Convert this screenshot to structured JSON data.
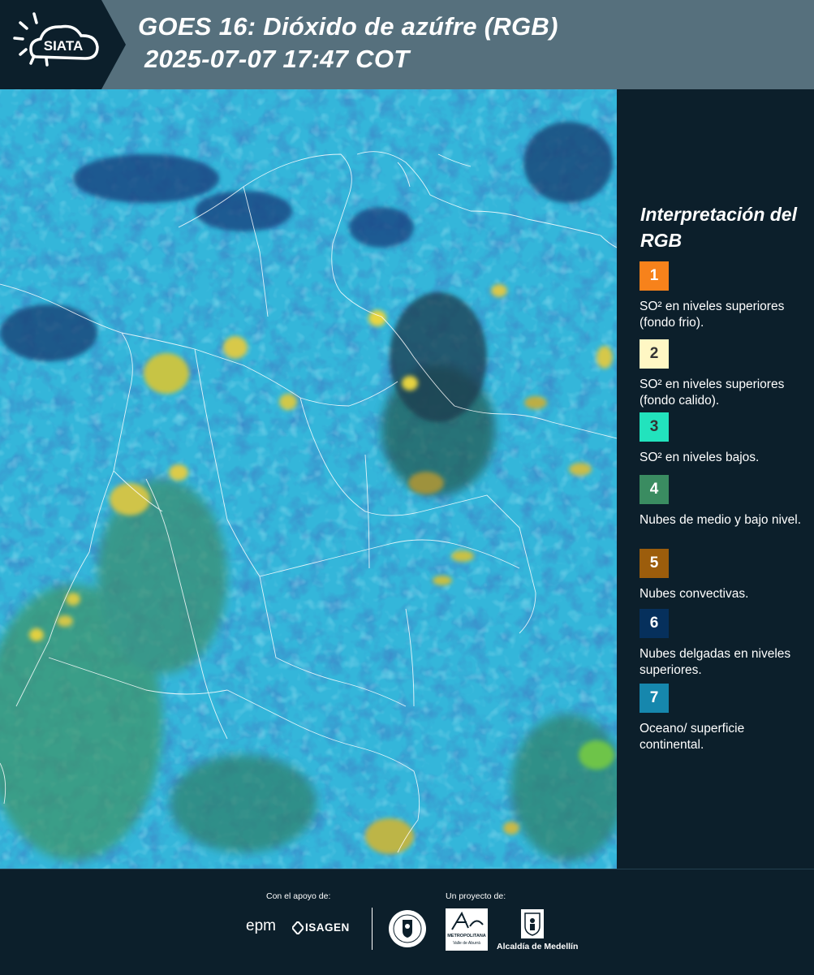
{
  "header": {
    "logo_text": "SIATA",
    "title_line1": "GOES 16: Dióxido de azúfre (RGB)",
    "title_line2": "2025-07-07 17:47 COT",
    "background_color": "#56707d"
  },
  "map": {
    "description_icon": "satellite-rgb-map",
    "base_color": "#35b7d9"
  },
  "legend": {
    "title": "Interpretación del RGB",
    "items": [
      {
        "number": "1",
        "color": "#f7821b",
        "label": "SO² en niveles superiores (fondo frio)."
      },
      {
        "number": "2",
        "color": "#fff7c4",
        "label": "SO² en niveles superiores (fondo calido)."
      },
      {
        "number": "3",
        "color": "#22e3bd",
        "label": "SO² en niveles bajos."
      },
      {
        "number": "4",
        "color": "#3a8c61",
        "label": "Nubes de medio y bajo nivel."
      },
      {
        "number": "5",
        "color": "#9c5d0c",
        "label": "Nubes convectivas."
      },
      {
        "number": "6",
        "color": "#06305c",
        "label": "Nubes delgadas en niveles superiores."
      },
      {
        "number": "7",
        "color": "#1687ad",
        "label": "Oceano/ superficie continental."
      }
    ]
  },
  "footer": {
    "support_label": "Con el apoyo de:",
    "project_label": "Un proyecto de:",
    "sponsors": {
      "epm": "epm",
      "isagen": "ISAGEN",
      "area_line1": "METROPOLITANA",
      "area_line2": "Valle de Aburrá",
      "alcaldia": "Alcaldía de Medellín"
    }
  }
}
